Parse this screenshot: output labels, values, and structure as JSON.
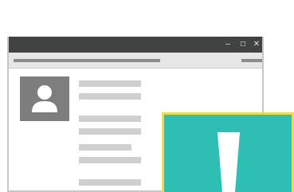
{
  "window": {
    "controls": {
      "minimize": "–",
      "maximize": "☐",
      "close": "✕"
    }
  },
  "colors": {
    "titlebar": "#3f4442",
    "frame": "#c7c7c7",
    "placeholder": "#cfcfcf",
    "avatar": "#7d7d7d",
    "tile_fill": "#2dbfb3",
    "tile_border": "#f4dd3a"
  },
  "icons": {
    "avatar": "user-icon",
    "tile": "exclamation-icon"
  }
}
